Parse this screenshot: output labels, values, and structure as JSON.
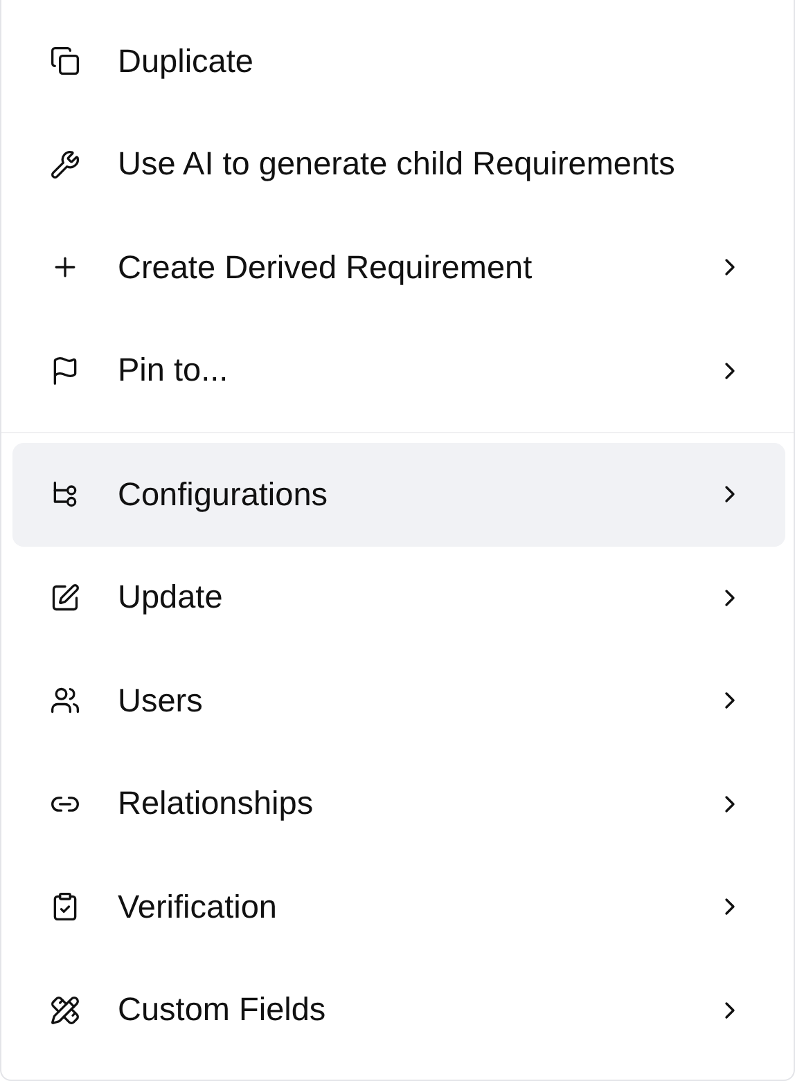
{
  "menu": {
    "groups": [
      {
        "items": [
          {
            "label": "Duplicate",
            "has_submenu": false,
            "selected": false
          },
          {
            "label": "Use AI to generate child Requirements",
            "has_submenu": false,
            "selected": false
          },
          {
            "label": "Create Derived Requirement",
            "has_submenu": true,
            "selected": false
          },
          {
            "label": "Pin to...",
            "has_submenu": true,
            "selected": false
          }
        ]
      },
      {
        "items": [
          {
            "label": "Configurations",
            "has_submenu": true,
            "selected": true
          },
          {
            "label": "Update",
            "has_submenu": true,
            "selected": false
          },
          {
            "label": "Users",
            "has_submenu": true,
            "selected": false
          },
          {
            "label": "Relationships",
            "has_submenu": true,
            "selected": false
          },
          {
            "label": "Verification",
            "has_submenu": true,
            "selected": false
          },
          {
            "label": "Custom Fields",
            "has_submenu": true,
            "selected": false
          }
        ]
      }
    ]
  }
}
